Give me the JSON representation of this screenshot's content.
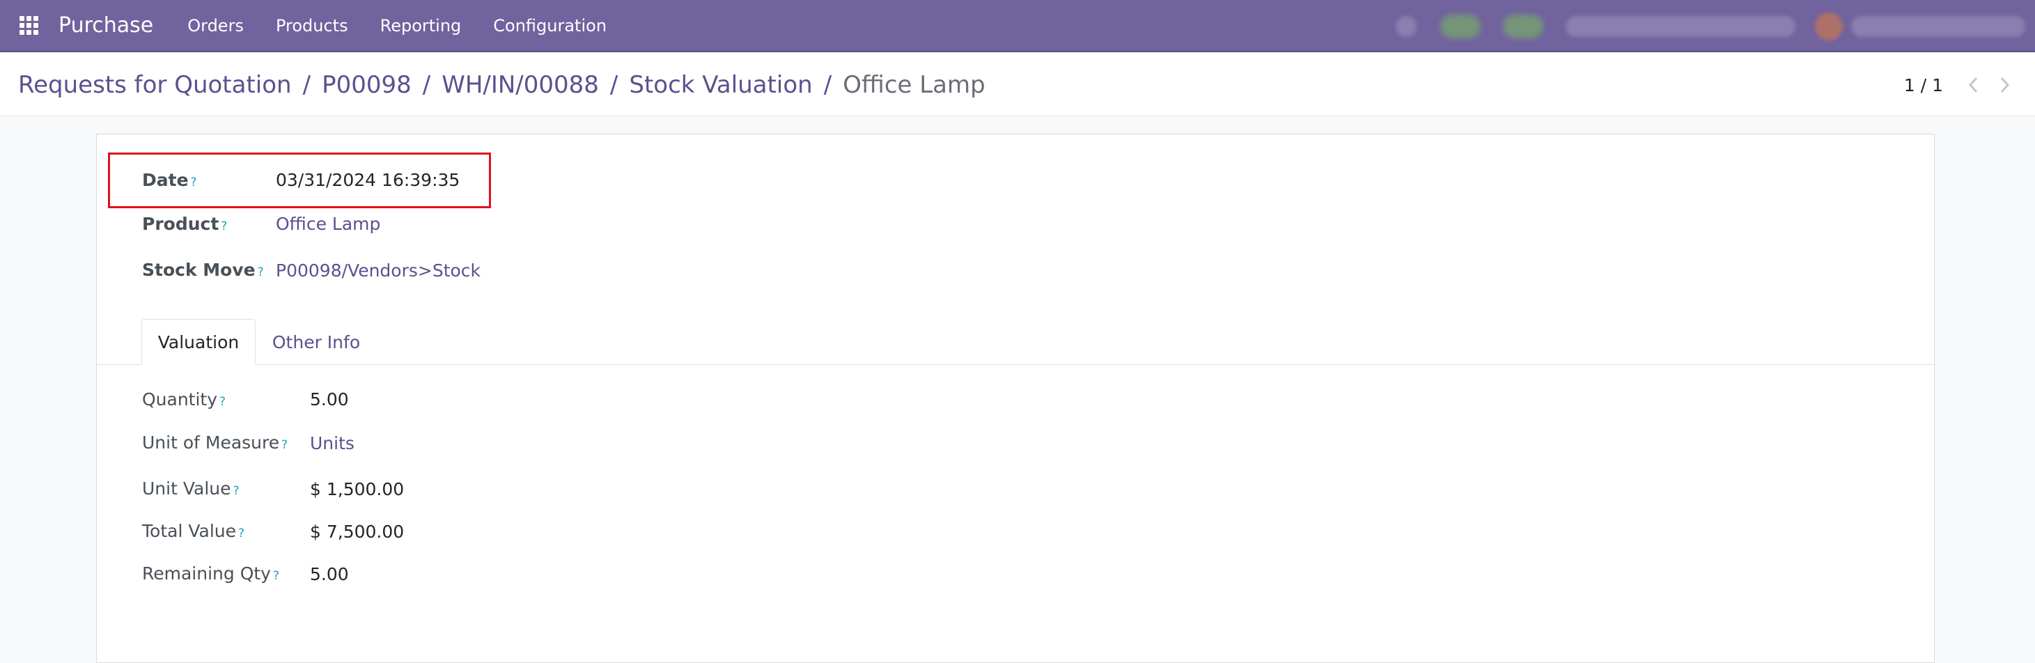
{
  "navbar": {
    "app_name": "Purchase",
    "menu": [
      "Orders",
      "Products",
      "Reporting",
      "Configuration"
    ],
    "icons": {
      "apps": "apps-grid-icon"
    },
    "colors": {
      "background": "#71639e"
    }
  },
  "breadcrumb": {
    "items": [
      "Requests for Quotation",
      "P00098",
      "WH/IN/00088",
      "Stock Valuation"
    ],
    "current": "Office Lamp",
    "separator": "/"
  },
  "pager": {
    "value": "1 / 1",
    "icons": {
      "prev": "chevron-left-icon",
      "next": "chevron-right-icon"
    }
  },
  "form": {
    "fields": {
      "date": {
        "label": "Date",
        "help": "?",
        "value": "03/31/2024 16:39:35"
      },
      "product": {
        "label": "Product",
        "help": "?",
        "value": "Office Lamp"
      },
      "stock_move": {
        "label": "Stock Move",
        "help": "?",
        "value": "P00098/Vendors>Stock"
      }
    },
    "tabs": [
      "Valuation",
      "Other Info"
    ],
    "active_tab": "Valuation",
    "valuation": {
      "quantity": {
        "label": "Quantity",
        "help": "?",
        "value": "5.00"
      },
      "uom": {
        "label": "Unit of Measure",
        "help": "?",
        "value": "Units"
      },
      "unit_value": {
        "label": "Unit Value",
        "help": "?",
        "value": "$ 1,500.00"
      },
      "total_value": {
        "label": "Total Value",
        "help": "?",
        "value": "$ 7,500.00"
      },
      "remaining_qty": {
        "label": "Remaining Qty",
        "help": "?",
        "value": "5.00"
      }
    }
  },
  "colors": {
    "link": "#5e4f8f",
    "highlight": "#e0121b",
    "help": "#17a2b8"
  }
}
